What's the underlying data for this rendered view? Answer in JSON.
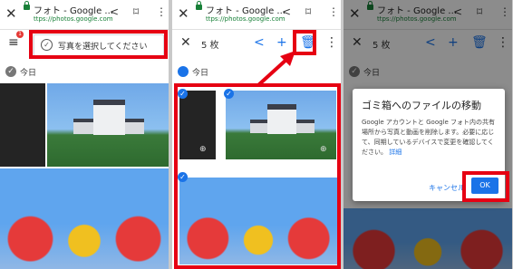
{
  "browser": {
    "title": "フォト - Google ...",
    "url": "ttps://photos.google.com"
  },
  "panel1": {
    "menu_badge": "1",
    "select_prompt": "写真を選択してください",
    "date_label": "今日"
  },
  "panel2": {
    "count": "5 枚",
    "date_label": "今日"
  },
  "panel3": {
    "count": "5 枚",
    "date_label": "今日",
    "dialog": {
      "title": "ゴミ箱へのファイルの移動",
      "body": "Google アカウントと Google フォト内の共有場所から写真と動画を削除します。必要に応じて、同期しているデバイスで変更を確認してください。",
      "link": "詳細",
      "cancel": "キャンセル",
      "ok": "OK"
    }
  },
  "colors": {
    "accent": "#1a73e8",
    "highlight": "#e60012"
  }
}
